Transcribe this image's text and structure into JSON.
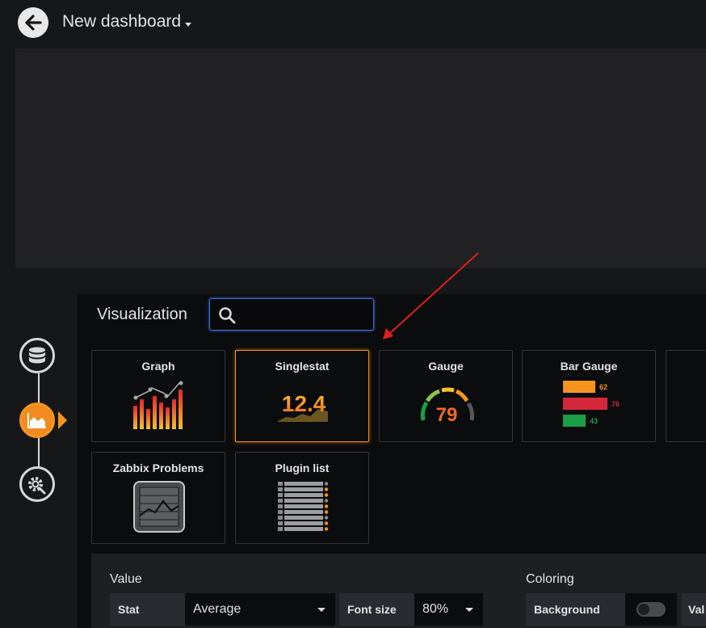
{
  "header": {
    "title": "New dashboard"
  },
  "visualization": {
    "title": "Visualization",
    "search": {
      "placeholder": "",
      "value": ""
    },
    "cards": [
      {
        "label": "Graph"
      },
      {
        "label": "Singlestat",
        "preview_value": "12.4",
        "selected": true
      },
      {
        "label": "Gauge",
        "preview_value": "79"
      },
      {
        "label": "Bar Gauge",
        "bar_values": [
          "62",
          "76",
          "43"
        ]
      },
      {
        "label": "Zabbix Problems"
      },
      {
        "label": "Plugin list"
      }
    ]
  },
  "options": {
    "value_section": {
      "heading": "Value",
      "stat_label": "Stat",
      "stat_value": "Average",
      "font_size_label": "Font size",
      "font_size_value": "80%"
    },
    "coloring_section": {
      "heading": "Coloring",
      "background_label": "Background",
      "background_enabled": false,
      "truncated_label": "Val"
    }
  },
  "colors": {
    "accent": "#f7941d",
    "search_border": "#3d71d9",
    "bar_orange": "#f7941d",
    "bar_red": "#d4283a",
    "bar_green": "#1a9e45",
    "annotation_arrow": "#e0201c"
  }
}
